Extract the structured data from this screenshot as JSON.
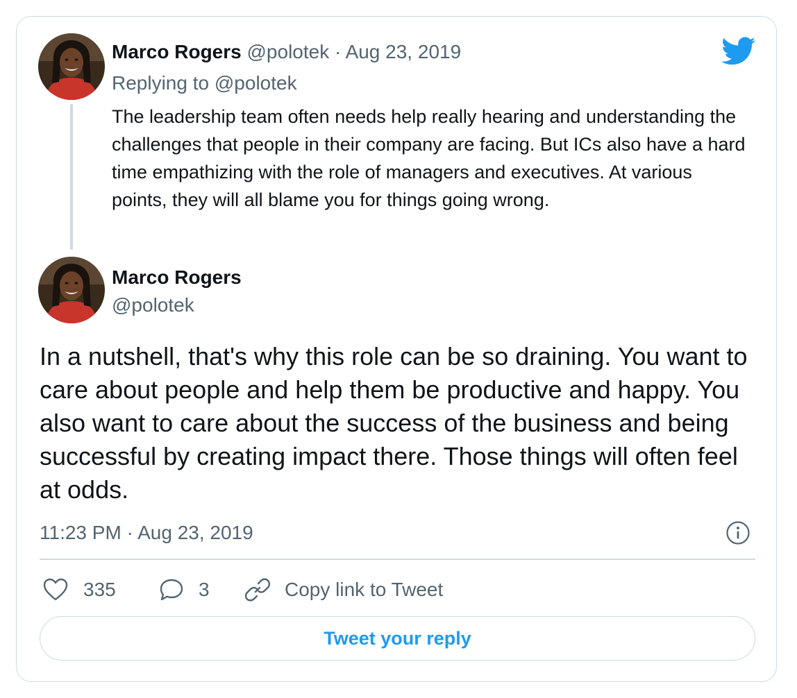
{
  "parent_tweet": {
    "author_name": "Marco Rogers",
    "author_handle": "@polotek",
    "separator": "·",
    "date": "Aug 23, 2019",
    "replying_label": "Replying to",
    "replying_to": "@polotek",
    "text": "The leadership team often needs help really hearing and understanding the challenges that people in their company are facing. But ICs also have a hard time empathizing with the role of managers and executives. At various points, they will all blame you for things going wrong."
  },
  "main_tweet": {
    "author_name": "Marco Rogers",
    "author_handle": "@polotek",
    "text": "In a nutshell, that's why this role can be so draining. You want to care about people and help them be productive and happy. You also want to care about the success of the business and being successful by creating impact there. Those things will often feel at odds.",
    "timestamp": "11:23 PM · Aug 23, 2019"
  },
  "actions": {
    "like_count": "335",
    "reply_count": "3",
    "copy_link_label": "Copy link to Tweet"
  },
  "reply_button_label": "Tweet your reply",
  "icons": {
    "brand": "twitter-bird-icon",
    "info": "info-icon",
    "like": "heart-icon",
    "reply": "speech-bubble-icon",
    "copy_link": "link-icon"
  },
  "colors": {
    "brand_blue": "#1d9bf0",
    "text_primary": "#0f1419",
    "text_secondary": "#536471",
    "border": "#cfd9de"
  }
}
